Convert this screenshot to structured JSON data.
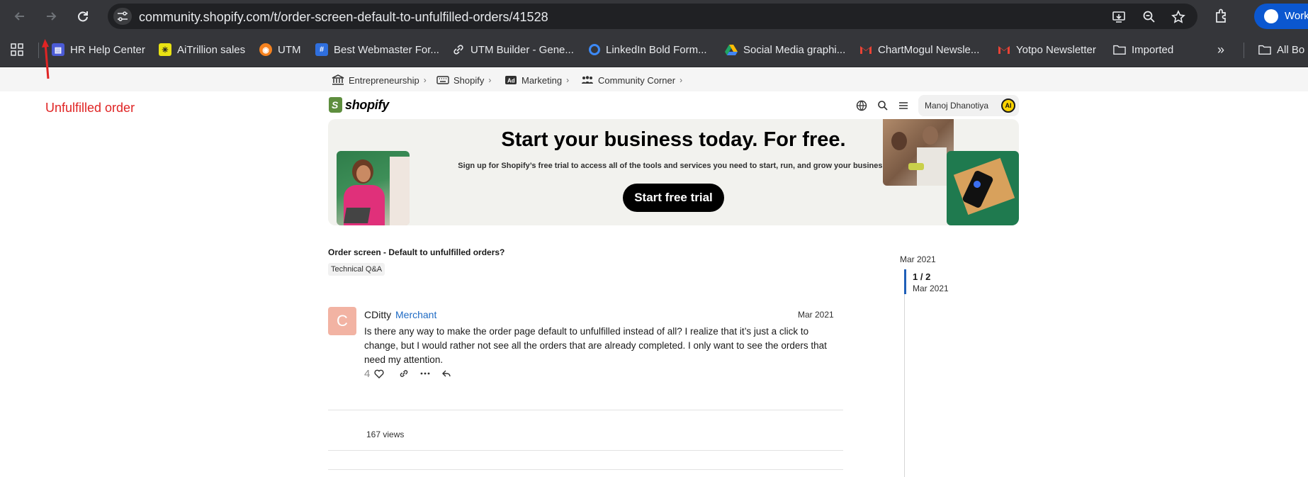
{
  "browser": {
    "url": "community.shopify.com/t/order-screen-default-to-unfulfilled-orders/41528",
    "profile_label": "Work"
  },
  "bookmarks": {
    "items": [
      {
        "label": "HR Help Center",
        "icon": "hr-help-favicon",
        "color": "#4b5bd6"
      },
      {
        "label": "AiTrillion sales",
        "icon": "aitrillion-favicon",
        "color": "#e9e313"
      },
      {
        "label": "UTM",
        "icon": "utm-favicon",
        "color": "#f5821f"
      },
      {
        "label": "Best Webmaster For...",
        "icon": "webmaster-favicon",
        "color": "#2f6fde"
      },
      {
        "label": "UTM Builder - Gene...",
        "icon": "link-icon",
        "color": "#e8eaed"
      },
      {
        "label": "LinkedIn Bold Form...",
        "icon": "linkedin-bold-favicon",
        "color": "#3d8af7"
      },
      {
        "label": "Social Media graphi...",
        "icon": "google-drive-icon",
        "color": "#1fa463"
      },
      {
        "label": "ChartMogul Newsle...",
        "icon": "gmail-icon",
        "color": "#ea4335"
      },
      {
        "label": "Yotpo Newsletter",
        "icon": "gmail-icon",
        "color": "#ea4335"
      },
      {
        "label": "Imported",
        "icon": "folder-icon",
        "color": "#e8eaed"
      }
    ],
    "overflow_label": "All Bo"
  },
  "breadcrumbs": [
    {
      "label": "Entrepreneurship",
      "icon": "bank-icon"
    },
    {
      "label": "Shopify",
      "icon": "keyboard-icon"
    },
    {
      "label": "Marketing",
      "icon": "ad-icon"
    },
    {
      "label": "Community Corner",
      "icon": "people-icon"
    }
  ],
  "annotation": {
    "text": "Unfulfilled order",
    "color": "#e02424"
  },
  "header": {
    "logo_text": "shopify",
    "user_name": "Manoj Dhanotiya",
    "user_initials": "AI"
  },
  "banner": {
    "title": "Start your business today. For free.",
    "subtitle": "Sign up for Shopify’s free trial to access all of the tools and services you need to start, run, and grow your business.",
    "cta": "Start free trial"
  },
  "topic": {
    "title": "Order screen - Default to unfulfilled orders?",
    "tag": "Technical Q&A"
  },
  "post": {
    "avatar_letter": "C",
    "author": "CDitty",
    "role": "Merchant",
    "date": "Mar 2021",
    "body": "Is there any way to make the order page default to unfulfilled instead of all? I realize that it’s just a click to change, but I would rather not see all the orders that are already completed. I only want to see the orders that need my attention.",
    "likes": "4",
    "views": "167 views"
  },
  "timeline": {
    "start_date": "Mar 2021",
    "position": "1 / 2",
    "position_date": "Mar 2021"
  },
  "colors": {
    "chrome_bg": "#35363a",
    "omnibox_bg": "#202124",
    "profile_blue": "#0b57d0",
    "shopify_green": "#5e8e3e",
    "role_blue": "#1f6bc4"
  }
}
